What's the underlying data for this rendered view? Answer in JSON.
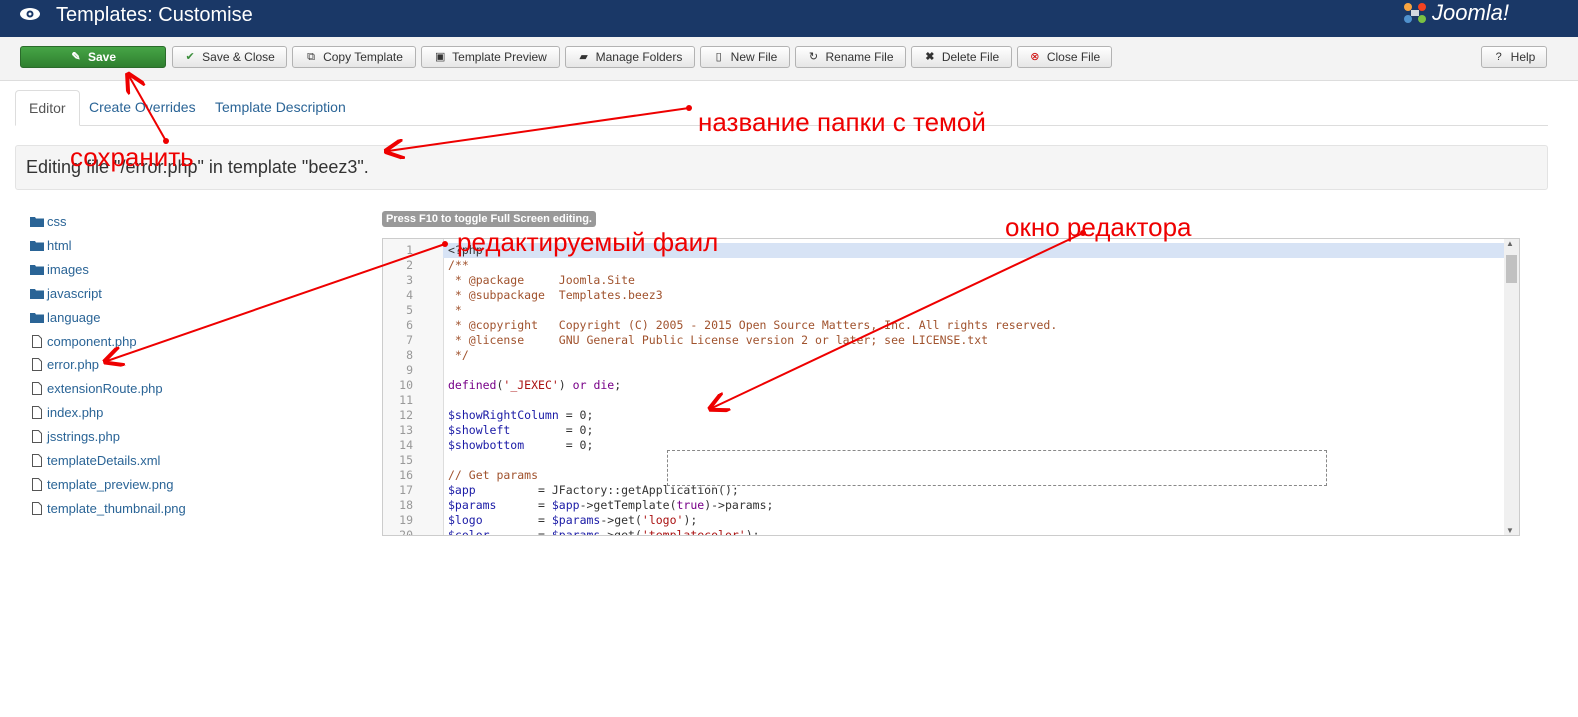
{
  "header": {
    "title": "Templates: Customise",
    "logo_text": "Joomla!"
  },
  "toolbar": {
    "save": "Save",
    "save_close": "Save & Close",
    "copy_template": "Copy Template",
    "template_preview": "Template Preview",
    "manage_folders": "Manage Folders",
    "new_file": "New File",
    "rename_file": "Rename File",
    "delete_file": "Delete File",
    "close_file": "Close File",
    "help": "Help"
  },
  "tabs": {
    "editor": "Editor",
    "create_overrides": "Create Overrides",
    "template_description": "Template Description"
  },
  "editing_text": "Editing file \"/error.php\" in template \"beez3\".",
  "tree": {
    "folders": [
      "css",
      "html",
      "images",
      "javascript",
      "language"
    ],
    "files": [
      "component.php",
      "error.php",
      "extensionRoute.php",
      "index.php",
      "jsstrings.php",
      "templateDetails.xml",
      "template_preview.png",
      "template_thumbnail.png"
    ]
  },
  "editor": {
    "hint": "Press F10 to toggle Full Screen editing.",
    "lines": [
      "<?php",
      "/**",
      " * @package     Joomla.Site",
      " * @subpackage  Templates.beez3",
      " *",
      " * @copyright   Copyright (C) 2005 - 2015 Open Source Matters, Inc. All rights reserved.",
      " * @license     GNU General Public License version 2 or later; see LICENSE.txt",
      " */",
      "",
      "defined('_JEXEC') or die;",
      "",
      "$showRightColumn = 0;",
      "$showleft        = 0;",
      "$showbottom      = 0;",
      "",
      "// Get params",
      "$app         = JFactory::getApplication();",
      "$params      = $app->getTemplate(true)->params;",
      "$logo        = $params->get('logo');",
      "$color       = $params->get('templatecolor');"
    ]
  },
  "annotations": {
    "save": "сохранить",
    "folder_name": "название папки с темой",
    "edited_file": "редактируемый фаил",
    "editor_window": "окно редактора"
  },
  "colors": {
    "header_bg": "#1a3867",
    "save_green": "#3b8e3b",
    "link": "#2a6496",
    "annotation": "#e00000"
  }
}
